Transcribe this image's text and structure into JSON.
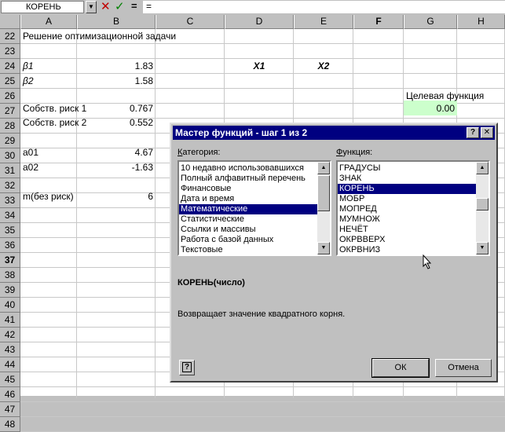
{
  "formula_bar": {
    "name_box": "КОРЕНЬ",
    "input": "="
  },
  "columns": [
    {
      "label": "A",
      "active": false
    },
    {
      "label": "B",
      "active": false
    },
    {
      "label": "C",
      "active": false
    },
    {
      "label": "D",
      "active": false
    },
    {
      "label": "E",
      "active": false
    },
    {
      "label": "F",
      "active": true
    },
    {
      "label": "G",
      "active": false
    },
    {
      "label": "H",
      "active": false
    }
  ],
  "rows": [
    "22",
    "23",
    "24",
    "25",
    "26",
    "27",
    "28",
    "29",
    "30",
    "31",
    "32",
    "33",
    "34",
    "35",
    "36",
    "37",
    "38",
    "39",
    "40",
    "41",
    "42",
    "43",
    "44",
    "45",
    "46",
    "47",
    "48"
  ],
  "active_row": "37",
  "cells": {
    "a22": "Решение оптимизационной задачи",
    "a24": "β1",
    "b24": "1.83",
    "d24": "X1",
    "e24": "X2",
    "a25": "β2",
    "b25": "1.58",
    "g26": "Целевая функция",
    "a27": "Собств. риск 1",
    "b27": "0.767",
    "g27": "0.00",
    "a28": "Собств. риск 2",
    "b28": "0.552",
    "a30": "a01",
    "b30": "4.67",
    "a31": "a02",
    "b31": "-1.63",
    "a33": "m(без риск)",
    "b33": "6"
  },
  "dialog": {
    "title": "Мастер функций - шаг 1 из 2",
    "help_btn": "?",
    "close_btn": "✕",
    "category_label_accel": "К",
    "category_label_rest": "атегория:",
    "function_label_accel": "Ф",
    "function_label_rest": "ункция:",
    "categories": [
      {
        "label": "10 недавно использовавшихся",
        "selected": false
      },
      {
        "label": "Полный алфавитный перечень",
        "selected": false
      },
      {
        "label": "Финансовые",
        "selected": false
      },
      {
        "label": "Дата и время",
        "selected": false
      },
      {
        "label": "Математические",
        "selected": true
      },
      {
        "label": "Статистические",
        "selected": false
      },
      {
        "label": "Ссылки и массивы",
        "selected": false
      },
      {
        "label": "Работа с базой данных",
        "selected": false
      },
      {
        "label": "Текстовые",
        "selected": false
      }
    ],
    "functions": [
      {
        "label": "ГРАДУСЫ",
        "selected": false
      },
      {
        "label": "ЗНАК",
        "selected": false
      },
      {
        "label": "КОРЕНЬ",
        "selected": true
      },
      {
        "label": "МОБР",
        "selected": false
      },
      {
        "label": "МОПРЕД",
        "selected": false
      },
      {
        "label": "МУМНОЖ",
        "selected": false
      },
      {
        "label": "НЕЧЁТ",
        "selected": false
      },
      {
        "label": "ОКРВВЕРХ",
        "selected": false
      },
      {
        "label": "ОКРВНИЗ",
        "selected": false
      }
    ],
    "signature": "КОРЕНЬ(число)",
    "description": "Возвращает значение квадратного корня.",
    "ok_label": "ОК",
    "cancel_label": "Отмена",
    "help_icon": "?"
  }
}
